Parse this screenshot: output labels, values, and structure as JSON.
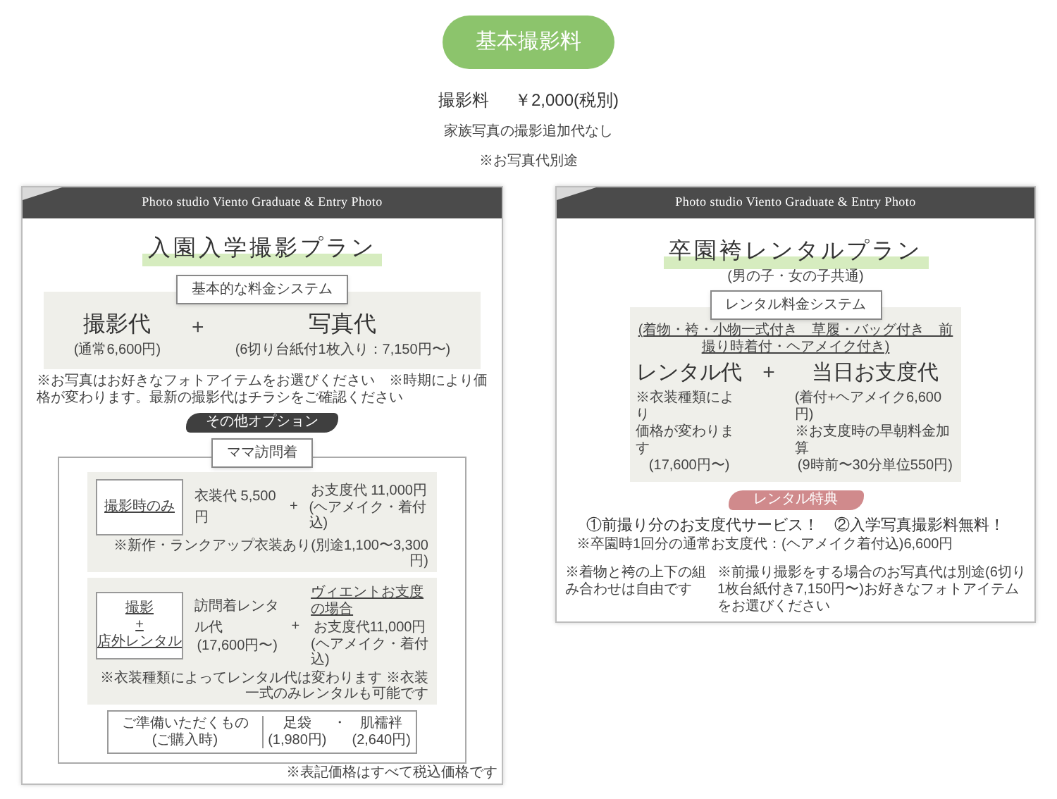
{
  "fee_header": {
    "label": "基本撮影料"
  },
  "basic_fee": {
    "label": "撮影料",
    "price": "￥2,000(税別)"
  },
  "fee_notes": [
    "家族写真の撮影追加代なし",
    "※お写真代別途"
  ],
  "entrance_plan": {
    "banner": "Photo studio Viento Graduate & Entry Photo",
    "title": "入園入学撮影プラン",
    "system": {
      "label": "基本的な料金システム",
      "operator": "+",
      "items": [
        {
          "name": "撮影代",
          "details": [
            "(通常6,600円)"
          ]
        },
        {
          "name": "写真代",
          "details": [
            "(6切り台紙付1枚入り：7,150円〜)"
          ]
        }
      ]
    },
    "system_note": "※お写真はお好きなフォトアイテムをお選びください　※時期により価格が変わります。最新の撮影代はチラシをご確認ください",
    "options_label": "その他オプション",
    "mama": {
      "label": "ママ訪問着",
      "rows": [
        {
          "plan": [
            "撮影時のみ"
          ],
          "left": "衣装代 5,500円",
          "operator": "+",
          "right": "お支度代 11,000円",
          "right_detail": "(ヘアメイク・着付込)",
          "note": "※新作・ランクアップ衣装あり(別途1,100〜3,300円)"
        },
        {
          "plan": [
            "撮影",
            "+",
            "店外レンタル"
          ],
          "left": "訪問着レンタル代",
          "left_detail": "(17,600円〜)",
          "operator": "+",
          "right_heading": "ヴィエントお支度の場合",
          "right": "お支度代11,000円",
          "right_detail": "(ヘアメイク・着付込)",
          "note": "※衣装種類によってレンタル代は変わります ※衣装一式のみレンタルも可能です"
        }
      ],
      "prepare": {
        "label": "ご準備いただくもの",
        "label_detail": "(ご購入時)",
        "separator": "・",
        "items": [
          {
            "name": "足袋",
            "price": "(1,980円)"
          },
          {
            "name": "肌襦袢",
            "price": "(2,640円)"
          }
        ]
      }
    },
    "footnote": "※表記価格はすべて税込価格です"
  },
  "rental_plan": {
    "banner": "Photo studio Viento Graduate & Entry Photo",
    "title": "卒園袴レンタルプラン",
    "subtitle": "(男の子・女の子共通)",
    "system": {
      "label": "レンタル料金システム",
      "includes": "(着物・袴・小物一式付き　草履・バッグ付き　前撮り時着付・ヘアメイク付き)",
      "operator": "+",
      "items": [
        {
          "name": "レンタル代",
          "details": [
            "※衣装種類により",
            "価格が変わります",
            "(17,600円〜)"
          ]
        },
        {
          "name": "当日お支度代",
          "details": [
            "(着付+ヘアメイク6,600円)",
            "※お支度時の早朝料金加算",
            "(9時前〜30分単位550円)"
          ]
        }
      ]
    },
    "perks_label": "レンタル特典",
    "perks": "①前撮り分のお支度代サービス！　②入学写真撮影料無料！",
    "perks_note": "※卒園時1回分の通常お支度代：(ヘアメイク着付込)6,600円",
    "footnotes": [
      "※着物と袴の上下の組み合わせは自由です",
      "※前撮り撮影をする場合のお写真代は別途(6切り1枚台紙付き7,150円〜)お好きなフォトアイテムをお選びください"
    ]
  }
}
